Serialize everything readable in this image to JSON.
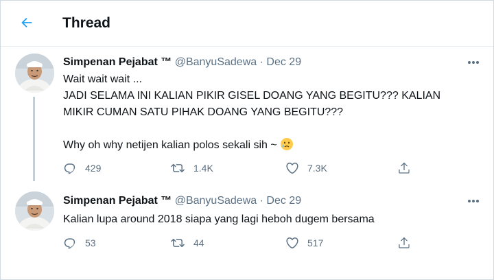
{
  "header": {
    "title": "Thread"
  },
  "tweets": [
    {
      "name": "Simpenan Pejabat ™",
      "handle": "@BanyuSadewa",
      "separator": "·",
      "date": "Dec 29",
      "lines": [
        "Wait wait wait ...",
        "JADI SELAMA INI KALIAN PIKIR GISEL DOANG YANG BEGITU??? KALIAN",
        "MIKIR CUMAN SATU PIHAK DOANG YANG BEGITU???",
        "",
        "Why oh why netijen kalian polos sekali sih ~"
      ],
      "emoji": "crying-face-emoji",
      "replies": "429",
      "retweets": "1.4K",
      "likes": "7.3K"
    },
    {
      "name": "Simpenan Pejabat ™",
      "handle": "@BanyuSadewa",
      "separator": "·",
      "date": "Dec 29",
      "lines": [
        "Kalian lupa around 2018 siapa yang lagi heboh dugem bersama"
      ],
      "replies": "53",
      "retweets": "44",
      "likes": "517"
    }
  ],
  "colors": {
    "accent": "#1da1f2",
    "muted": "#5b7083",
    "text": "#0f1419",
    "border": "#cfd9de",
    "thread_line": "#c4cfd6"
  },
  "icons": {
    "back": "arrow-left-icon",
    "more": "more-dots-icon",
    "reply": "reply-icon",
    "retweet": "retweet-icon",
    "like": "heart-icon",
    "share": "share-icon"
  }
}
